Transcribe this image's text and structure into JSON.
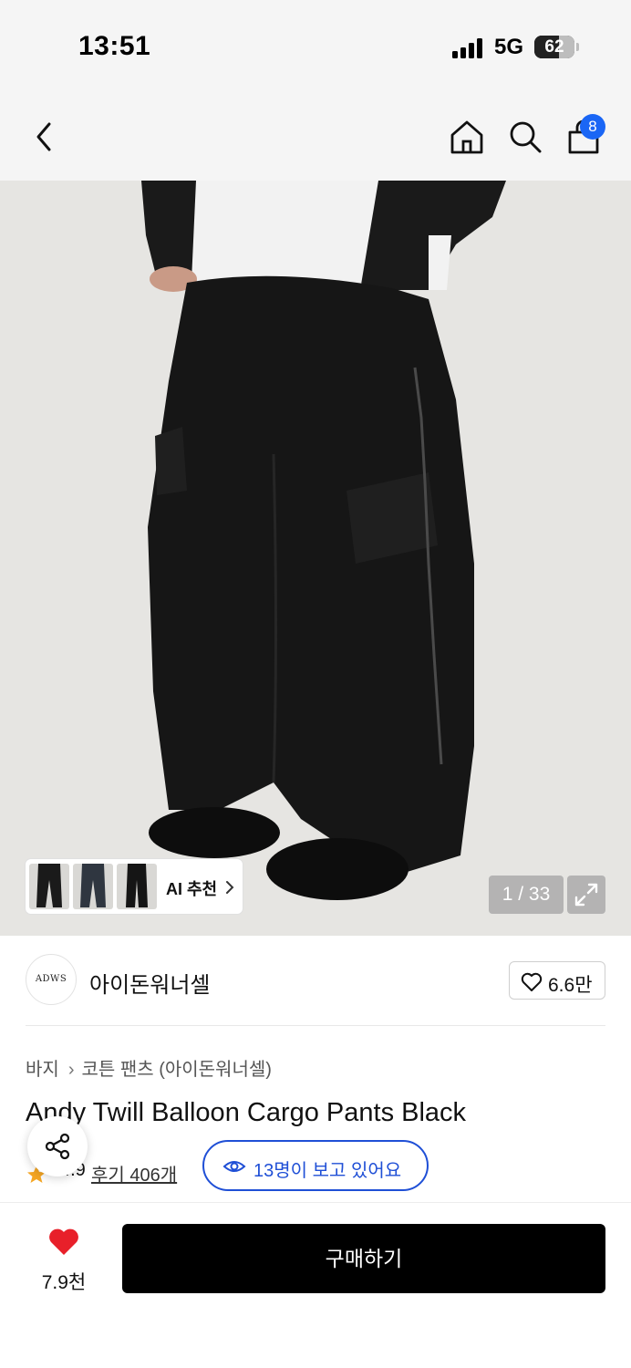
{
  "status_bar": {
    "time": "13:51",
    "network": "5G",
    "battery": "62",
    "battery_level": 0.62
  },
  "nav": {
    "back_icon": "chevron-left-icon",
    "home_icon": "home-icon",
    "search_icon": "search-icon",
    "cart_icon": "shopping-bag-icon",
    "cart_badge": "8"
  },
  "gallery": {
    "ai_recommend_label": "AI 추천",
    "page_current": "1",
    "page_total": "33",
    "page_counter": "1 / 33",
    "expand_icon": "expand-icon"
  },
  "brand": {
    "logo_text": "ADWS",
    "name": "아이돈워너셀",
    "like_count": "6.6만"
  },
  "product": {
    "breadcrumb": [
      "바지",
      "코튼 팬츠 (아이돈워너셀)"
    ],
    "title": "Andy Twill Balloon Cargo Pants Black",
    "rating": "4.9",
    "review_label": "후기 406개",
    "viewers_label": "13명이 보고 있어요"
  },
  "bottom_bar": {
    "like_count": "7.9천",
    "buy_label": "구매하기"
  },
  "colors": {
    "accent_blue": "#1f4fd6",
    "badge_blue": "#1a66f5",
    "heart_red": "#e8202a",
    "star_orange": "#f5a623",
    "buy_black": "#000000"
  }
}
